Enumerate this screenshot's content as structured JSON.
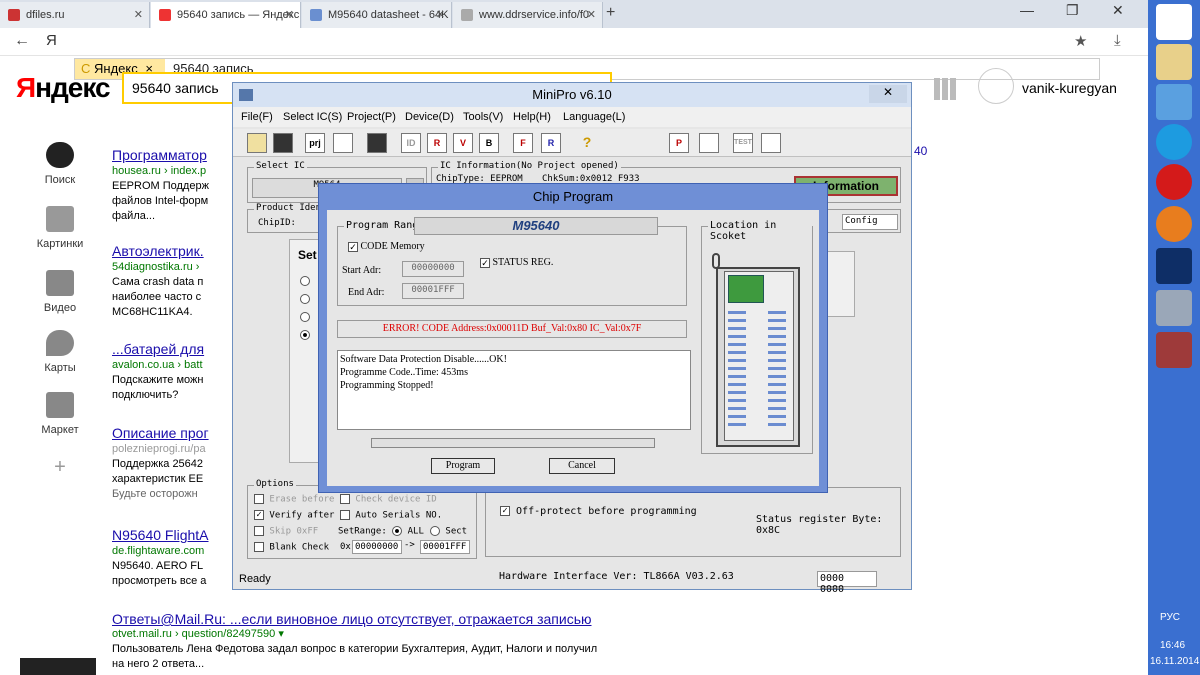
{
  "browser": {
    "tabs": [
      {
        "label": "dfiles.ru"
      },
      {
        "label": "95640 запись — Яндекс"
      },
      {
        "label": "M95640 datasheet - 64K"
      },
      {
        "label": "www.ddrservice.info/f0"
      }
    ],
    "new_tab": "+",
    "nav": {
      "back": "←",
      "ya": "Я",
      "reload": "C"
    },
    "address": {
      "site": "Яндекс",
      "close": "×",
      "query": "95640 запись"
    },
    "star": "★",
    "download": "⤓",
    "menu": "≡"
  },
  "yandex": {
    "logo_first": "Я",
    "logo_rest": "ндекс",
    "search_value": "95640 запись",
    "user": "vanik-kuregyan",
    "extra_num": "40",
    "sidebar": [
      {
        "label": "Поиск"
      },
      {
        "label": "Картинки"
      },
      {
        "label": "Видео"
      },
      {
        "label": "Карты"
      },
      {
        "label": "Маркет"
      },
      {
        "label": "+"
      }
    ],
    "results": [
      {
        "title": "Программатор",
        "url": "housea.ru › index.p",
        "snippet": [
          "EEPROM Поддерж",
          "файлов Intel-форм",
          "файла..."
        ]
      },
      {
        "title": "Автоэлектрик.",
        "url": "54diagnostika.ru ›",
        "snippet": [
          "Сама crash data п",
          "наиболее часто с",
          "MC68HC11KA4."
        ]
      },
      {
        "title": "...батарей для",
        "url": "avalon.co.ua › batt",
        "snippet": [
          "Подскажите можн",
          "подключить?"
        ]
      },
      {
        "title": "Описание прог",
        "url": "polezniepr​ogi.ru/pa",
        "snippet": [
          "Поддержка 25642",
          "характеристик EE",
          "Будьте осторожн"
        ]
      },
      {
        "title": "N95640 FlightA",
        "url": "de.flightaware.com",
        "snippet": [
          "N95640. AERO FL",
          "просмотреть все а"
        ]
      }
    ],
    "last_result": {
      "title": "Ответы@Mail.Ru: ...если виновное лицо отсутствует, отражается записью",
      "url": "otvet.mail.ru › question/82497590 ▾",
      "snippet": [
        "Пользователь Лена Федотова задал вопрос в категории Бухгалтерия, Аудит, Налоги и получил",
        "на него 2 ответа..."
      ]
    }
  },
  "minipro": {
    "title": "MiniPro v6.10",
    "menu": [
      "File(F)",
      "Select IC(S)",
      "Project(P)",
      "Device(D)",
      "Tools(V)",
      "Help(H)",
      "Language(L)"
    ],
    "select_ic_label": "Select IC",
    "ic_value": "M9564",
    "ic_info_label": "IC Information(No Project opened)",
    "chip_type": "ChipType:  EEPROM",
    "chksum": "ChkSum:0x0012 F933",
    "information_btn": "Information",
    "product_label": "Product Iden",
    "chip_id": "ChipID:",
    "tab_config": "Config",
    "tab_mo": "mo",
    "set_label": "Set",
    "options_label": "Options",
    "options": {
      "erase_before": "Erase before",
      "check_device_id": "Check device ID",
      "verify_after": "Verify after",
      "auto_serials": "Auto Serials NO.",
      "skip_0xff": "Skip 0xFF",
      "set_range": "SetRange:",
      "all": "ALL",
      "sect": "Sect",
      "blank_check": "Blank Check",
      "ox": "0x",
      "range_from": "00000000",
      "range_to": "00001FFF",
      "arrow": "->"
    },
    "off_protect": "Off-protect before programming",
    "status_reg_byte": "Status register Byte: 0x8C",
    "status_ready": "Ready",
    "hw_interface": "Hardware Interface Ver: TL866A V03.2.63",
    "counter": "0000 0000"
  },
  "chip_program": {
    "title": "Chip Program",
    "program_range": "Program Range",
    "chip_name": "M95640",
    "code_memory": "CODE Memory",
    "status_reg": "STATUS REG.",
    "start_label": "Start Adr:",
    "start_value": "00000000",
    "end_label": "End Adr:",
    "end_value": "00001FFF",
    "error": "ERROR!   CODE Address:0x00011D   Buf_Val:0x80   IC_Val:0x7F",
    "log": [
      "Software Data Protection Disable......OK!",
      "Programme Code..Time: 453ms",
      "Programming Stopped!"
    ],
    "progress": 0,
    "program_btn": "Program",
    "cancel_btn": "Cancel",
    "location_label": "Location in Scoket"
  },
  "taskbar": {
    "lang": "РУС",
    "time": "16:46",
    "date": "16.11.2014"
  }
}
